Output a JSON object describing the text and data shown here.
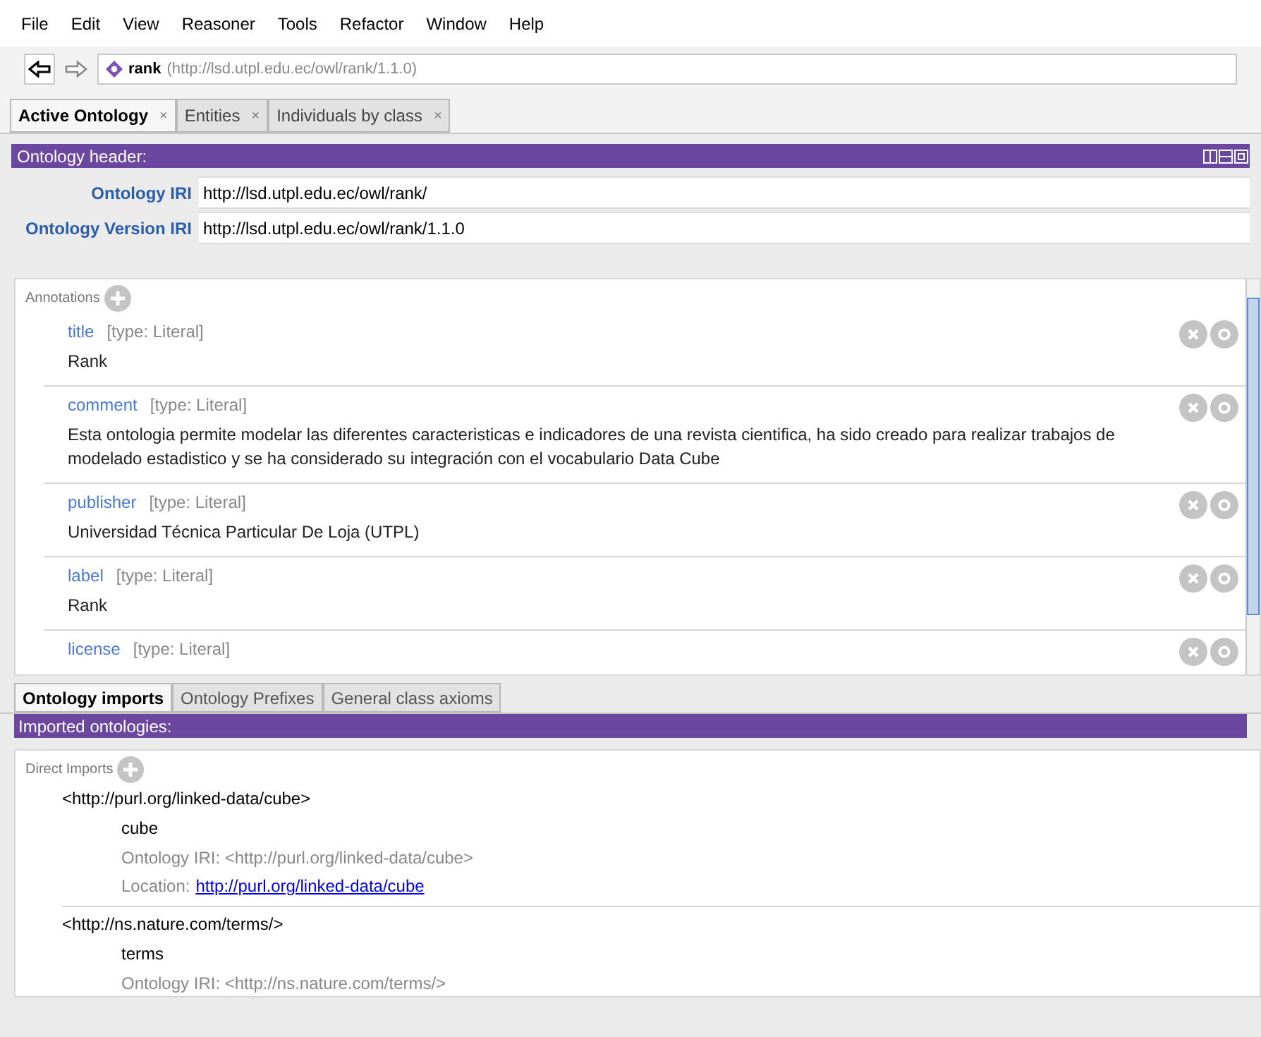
{
  "menu": [
    "File",
    "Edit",
    "View",
    "Reasoner",
    "Tools",
    "Refactor",
    "Window",
    "Help"
  ],
  "nav": {
    "entity": "rank",
    "iri": "(http://lsd.utpl.edu.ec/owl/rank/1.1.0)"
  },
  "tabs": [
    {
      "label": "Active Ontology",
      "close": "×",
      "selected": true
    },
    {
      "label": "Entities",
      "close": "×",
      "selected": false
    },
    {
      "label": "Individuals by class",
      "close": "×",
      "selected": false
    }
  ],
  "header": {
    "title": "Ontology header:",
    "fields": [
      {
        "label": "Ontology IRI",
        "value": "http://lsd.utpl.edu.ec/owl/rank/"
      },
      {
        "label": "Ontology Version IRI",
        "value": "http://lsd.utpl.edu.ec/owl/rank/1.1.0"
      }
    ]
  },
  "annotations": {
    "title": "Annotations",
    "items": [
      {
        "property": "title",
        "type": "[type: Literal]",
        "value": "Rank"
      },
      {
        "property": "comment",
        "type": "[type: Literal]",
        "value": "Esta ontologia permite modelar las diferentes caracteristicas e indicadores de una revista cientifica, ha sido creado para realizar trabajos de modelado estadistico y se ha considerado su integración con el vocabulario Data Cube"
      },
      {
        "property": "publisher",
        "type": "[type: Literal]",
        "value": "Universidad Técnica Particular De Loja (UTPL)"
      },
      {
        "property": "label",
        "type": "[type: Literal]",
        "value": "Rank"
      },
      {
        "property": "license",
        "type": "[type: Literal]"
      }
    ]
  },
  "bottom_tabs": [
    {
      "label": "Ontology imports",
      "selected": true
    },
    {
      "label": "Ontology Prefixes",
      "selected": false
    },
    {
      "label": "General class axioms",
      "selected": false
    }
  ],
  "imports": {
    "title": "Imported ontologies:",
    "section": "Direct Imports",
    "items": [
      {
        "uri": "<http://purl.org/linked-data/cube>",
        "name": "cube",
        "iri": "Ontology IRI: <http://purl.org/linked-data/cube>",
        "location_label": "Location:",
        "location": "http://purl.org/linked-data/cube"
      },
      {
        "uri": "<http://ns.nature.com/terms/>",
        "name": "terms",
        "iri": "Ontology IRI: <http://ns.nature.com/terms/>"
      }
    ]
  }
}
